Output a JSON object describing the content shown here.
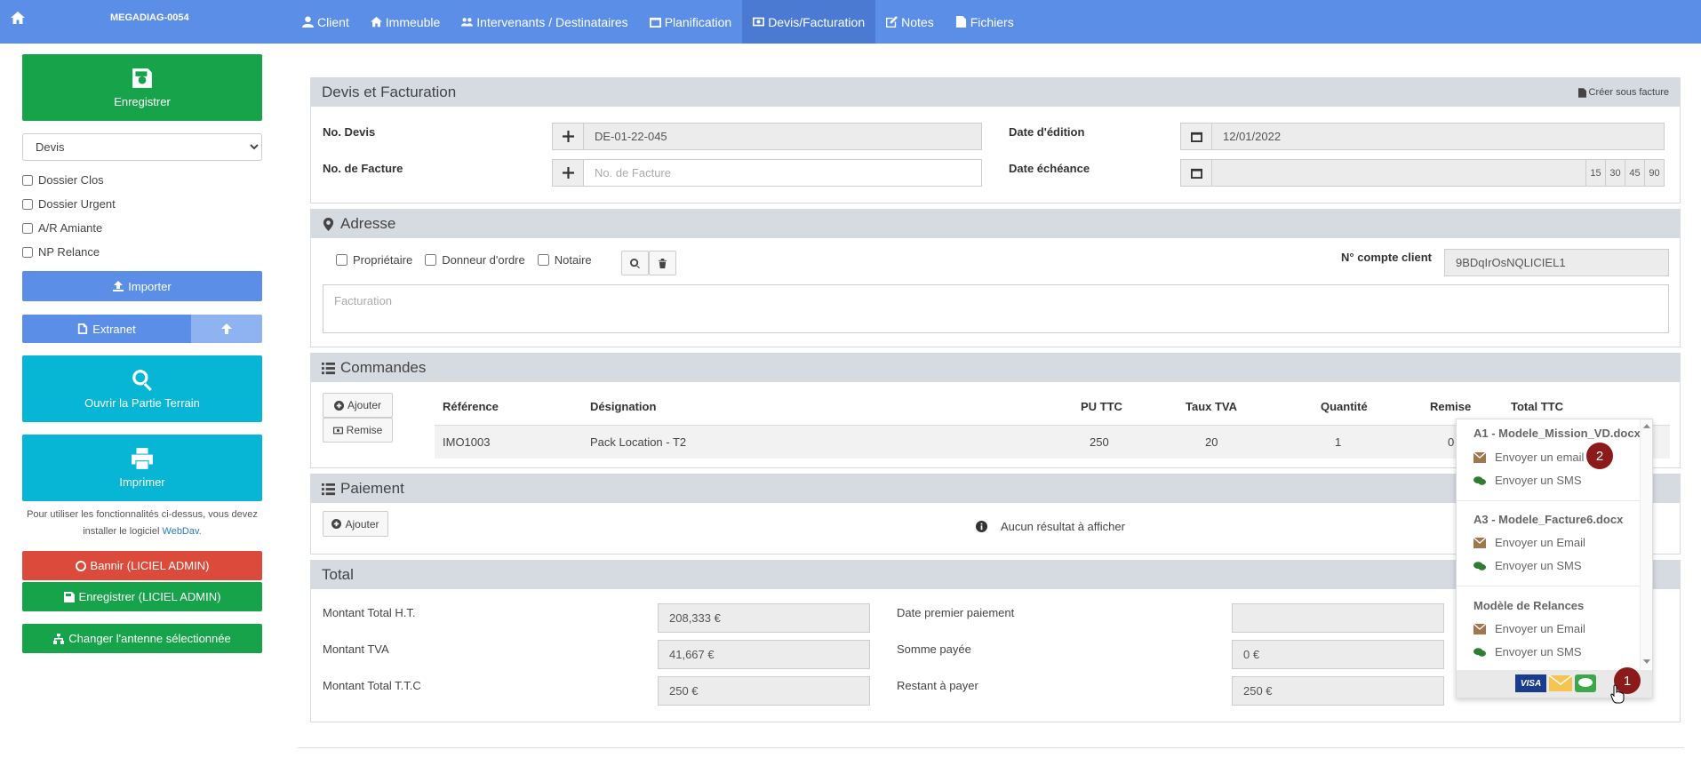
{
  "topnav": {
    "brand": "MEGADIAG-0054",
    "tabs": [
      "Client",
      "Immeuble",
      "Intervenants / Destinataires",
      "Planification",
      "Devis/Facturation",
      "Notes",
      "Fichiers"
    ]
  },
  "sidebar": {
    "save_label": "Enregistrer",
    "select_value": "Devis",
    "checkboxes": [
      "Dossier Clos",
      "Dossier Urgent",
      "A/R Amiante",
      "NP Relance"
    ],
    "import_label": "Importer",
    "extranet_label": "Extranet",
    "terrain_label": "Ouvrir la Partie Terrain",
    "print_label": "Imprimer",
    "note_text": "Pour utiliser les fonctionnalités ci-dessus, vous devez installer le logiciel",
    "note_link": "WebDav.",
    "ban_label": "Bannir (LICIEL ADMIN)",
    "save_admin_label": "Enregistrer (LICIEL ADMIN)",
    "antenna_label": "Changer l'antenne sélectionnée"
  },
  "devis": {
    "title": "Devis et Facturation",
    "create_invoice": "Créer sous facture",
    "no_devis_label": "No. Devis",
    "no_devis_value": "DE-01-22-045",
    "no_facture_label": "No. de Facture",
    "no_facture_placeholder": "No. de Facture",
    "date_edition_label": "Date d'édition",
    "date_edition_value": "12/01/2022",
    "date_echeance_label": "Date échéance",
    "quick_days": [
      "15",
      "30",
      "45",
      "90"
    ]
  },
  "adresse": {
    "title": "Adresse",
    "checks": [
      "Propriétaire",
      "Donneur d'ordre",
      "Notaire"
    ],
    "compte_label": "N° compte client",
    "compte_value": "9BDqIrOsNQLICIEL1",
    "facturation_placeholder": "Facturation"
  },
  "commandes": {
    "title": "Commandes",
    "add_label": "Ajouter",
    "remise_label": "Remise",
    "headers": [
      "Référence",
      "Désignation",
      "PU TTC",
      "Taux TVA",
      "Quantité",
      "Remise",
      "Total TTC"
    ],
    "row": [
      "IMO1003",
      "Pack Location - T2",
      "250",
      "20",
      "1",
      "0"
    ]
  },
  "paiement": {
    "title": "Paiement",
    "add_label": "Ajouter",
    "empty_text": "Aucun résultat à afficher"
  },
  "total": {
    "title": "Total",
    "ht_label": "Montant Total H.T.",
    "ht_value": "208,333 €",
    "tva_label": "Montant TVA",
    "tva_value": "41,667 €",
    "ttc_label": "Montant Total T.T.C",
    "ttc_value": "250 €",
    "premier_label": "Date premier paiement",
    "premier_value": "",
    "somme_label": "Somme payée",
    "somme_value": "0 €",
    "restant_label": "Restant à payer",
    "restant_value": "250 €"
  },
  "popup": {
    "sections": [
      {
        "title": "A1 - Modele_Mission_VD.docx",
        "email": "Envoyer un email",
        "sms": "Envoyer un SMS"
      },
      {
        "title": "A3 - Modele_Facture6.docx",
        "email": "Envoyer un Email",
        "sms": "Envoyer un SMS"
      },
      {
        "title": "Modèle de Relances",
        "email": "Envoyer un Email",
        "sms": "Envoyer un SMS"
      }
    ],
    "badge1": "1",
    "badge2": "2",
    "visa": "VISA"
  }
}
